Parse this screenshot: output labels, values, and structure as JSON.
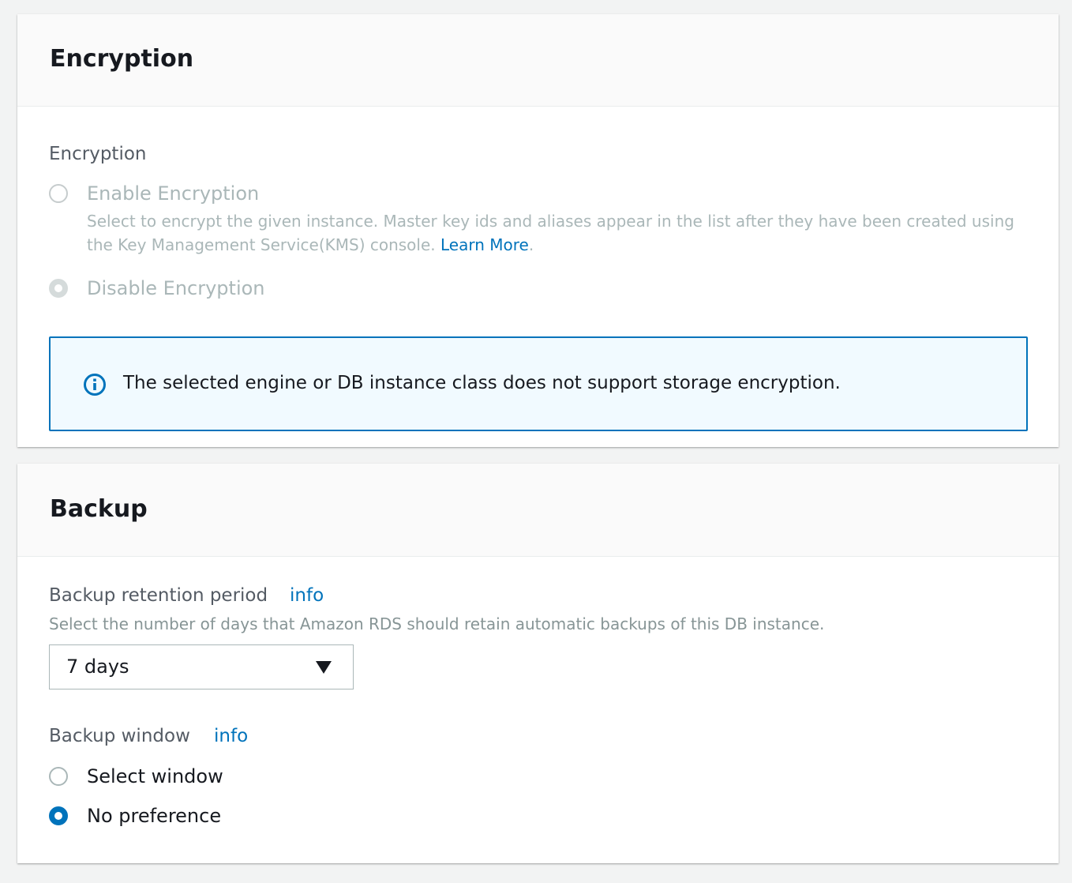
{
  "encryption_panel": {
    "title": "Encryption",
    "field_label": "Encryption",
    "options": [
      {
        "label": "Enable Encryption",
        "selected": false,
        "disabled": true,
        "description": "Select to encrypt the given instance. Master key ids and aliases appear in the list after they have been created using the Key Management Service(KMS) console.",
        "description_link": "Learn More",
        "description_suffix": "."
      },
      {
        "label": "Disable Encryption",
        "selected": true,
        "disabled": true
      }
    ],
    "alert": {
      "icon": "info-circle-icon",
      "text": "The selected engine or DB instance class does not support storage encryption."
    }
  },
  "backup_panel": {
    "title": "Backup",
    "retention": {
      "label": "Backup retention period",
      "info_link": "info",
      "description": "Select the number of days that Amazon RDS should retain automatic backups of this DB instance.",
      "selected_value": "7 days",
      "dropdown_icon": "caret-down-icon"
    },
    "window": {
      "label": "Backup window",
      "info_link": "info",
      "options": [
        {
          "label": "Select window",
          "selected": false
        },
        {
          "label": "No preference",
          "selected": true
        }
      ]
    }
  },
  "colors": {
    "accent": "#0073bb",
    "page_background": "#f2f3f3",
    "header_background": "#fafafa",
    "alert_background": "#f1faff",
    "disabled_text": "#aab7b8",
    "secondary_text": "#545b64"
  }
}
